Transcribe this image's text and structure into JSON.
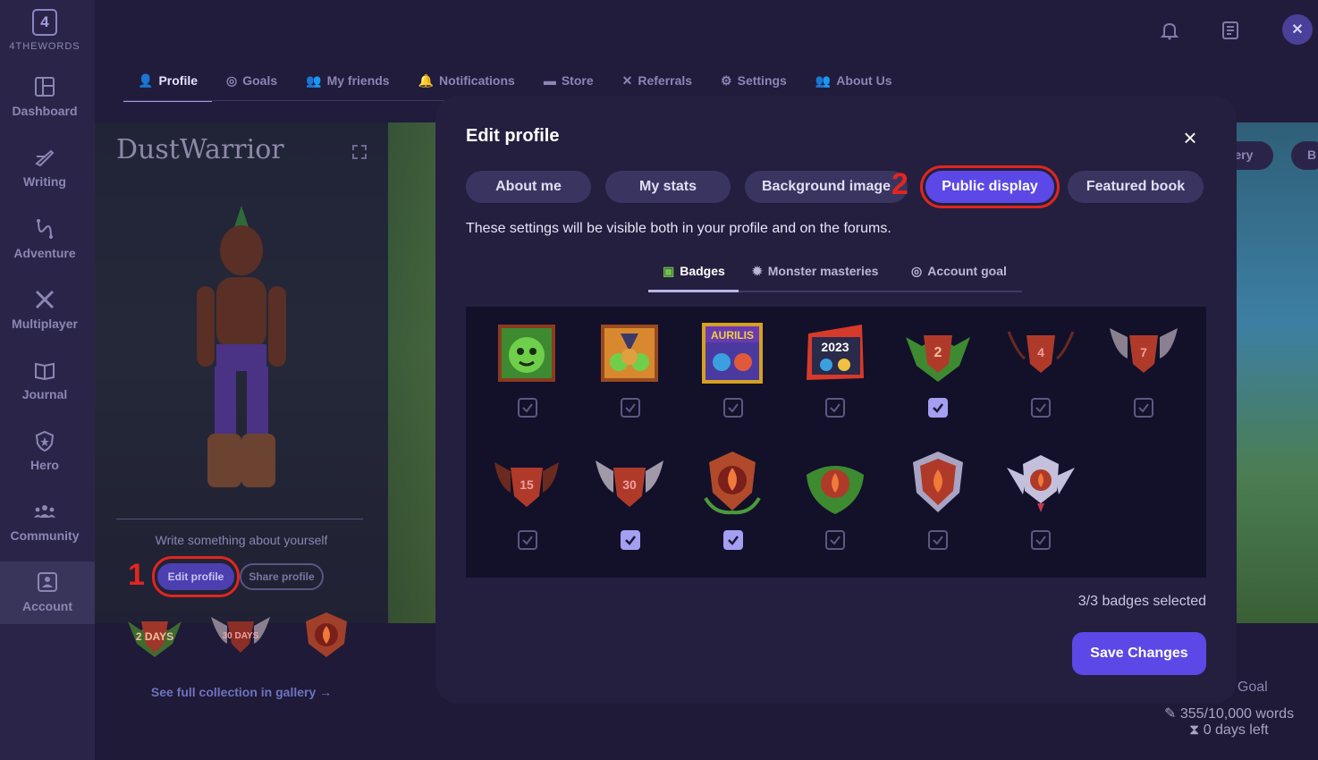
{
  "brand": {
    "logo_glyph": "4",
    "logo_text": "4THEWORDS"
  },
  "sidebar": {
    "items": [
      {
        "label": "Dashboard",
        "icon": "dashboard-icon"
      },
      {
        "label": "Writing",
        "icon": "writing-icon"
      },
      {
        "label": "Adventure",
        "icon": "adventure-icon"
      },
      {
        "label": "Multiplayer",
        "icon": "multiplayer-icon"
      },
      {
        "label": "Journal",
        "icon": "journal-icon"
      },
      {
        "label": "Hero",
        "icon": "hero-icon"
      },
      {
        "label": "Community",
        "icon": "community-icon"
      },
      {
        "label": "Account",
        "icon": "account-icon",
        "active": true
      }
    ]
  },
  "top_tabs": [
    {
      "label": "Profile",
      "active": true
    },
    {
      "label": "Goals"
    },
    {
      "label": "My friends"
    },
    {
      "label": "Notifications"
    },
    {
      "label": "Store"
    },
    {
      "label": "Referrals"
    },
    {
      "label": "Settings"
    },
    {
      "label": "About Us"
    }
  ],
  "profile": {
    "name": "DustWarrior",
    "about_placeholder": "Write something about yourself",
    "edit_label": "Edit profile",
    "share_label": "Share profile",
    "gallery_link": "See full collection in gallery →",
    "mini_badges": [
      "2 DAYS",
      "30 DAYS",
      "flame"
    ]
  },
  "annotations": {
    "step1": "1",
    "step2": "2"
  },
  "right_panel": {
    "tab_gallery": "llery",
    "tab_b": "B",
    "goal_title": "t Goal",
    "words": "355/10,000 words",
    "days_left": "0 days left"
  },
  "modal": {
    "title": "Edit profile",
    "close": "×",
    "tabs": [
      {
        "label": "About me"
      },
      {
        "label": "My stats"
      },
      {
        "label": "Background image"
      },
      {
        "label": "Public display",
        "active": true
      },
      {
        "label": "Featured book"
      }
    ],
    "description": "These settings will be visible both in your profile and on the forums.",
    "subtabs": [
      {
        "label": "Badges",
        "active": true
      },
      {
        "label": "Monster masteries"
      },
      {
        "label": "Account goal"
      }
    ],
    "badges": [
      {
        "label": "",
        "checked": false
      },
      {
        "label": "",
        "checked": false
      },
      {
        "label": "AURILIS",
        "checked": false
      },
      {
        "label": "2023",
        "checked": false
      },
      {
        "label": "2",
        "checked": true
      },
      {
        "label": "4",
        "checked": false
      },
      {
        "label": "7",
        "checked": false
      },
      {
        "label": "15",
        "checked": false
      },
      {
        "label": "30",
        "checked": true
      },
      {
        "label": "",
        "checked": true
      },
      {
        "label": "",
        "checked": false
      },
      {
        "label": "",
        "checked": false
      },
      {
        "label": "",
        "checked": false
      }
    ],
    "count_text": "3/3 badges selected",
    "save_label": "Save Changes"
  },
  "colors": {
    "accent": "#5b48e6",
    "annotation_red": "#e0261f",
    "panel_bg": "#241f3f",
    "grid_bg": "#13102a"
  }
}
